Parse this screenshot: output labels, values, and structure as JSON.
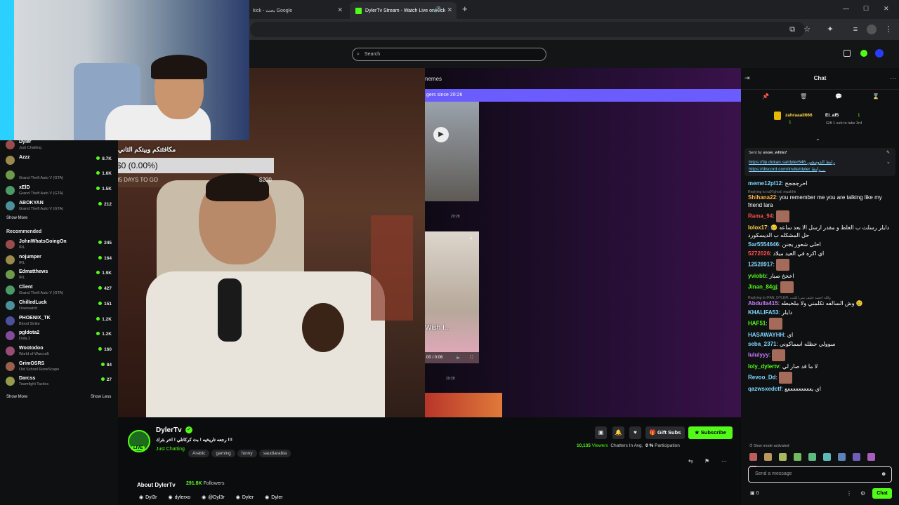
{
  "browser": {
    "tabs": [
      {
        "title": "kick - بحث Google",
        "active": false
      },
      {
        "title": "DylerTv Stream - Watch Live on Kick",
        "active": true
      }
    ],
    "new_tab": "+",
    "window_controls": {
      "minimize": "—",
      "maximize": "☐",
      "close": "✕"
    }
  },
  "kick": {
    "search_placeholder": "Search"
  },
  "sidebar": {
    "following": [
      {
        "name": "Dyler",
        "game": "Just Chatting",
        "viewers": ""
      },
      {
        "name": "Azzz",
        "game": "",
        "viewers": "8.7K"
      },
      {
        "name": "",
        "game": "Grand Theft Auto V (GTA)",
        "viewers": "1.6K"
      },
      {
        "name": "xElD",
        "game": "Grand Theft Auto V (GTA)",
        "viewers": "1.5K"
      },
      {
        "name": "ABOKYAN",
        "game": "Grand Theft Auto V (GTA)",
        "viewers": "212"
      }
    ],
    "show_more": "Show More",
    "recommended_label": "Recommended",
    "recommended": [
      {
        "name": "JohnWhatsGoingOn",
        "game": "IRL",
        "viewers": "245"
      },
      {
        "name": "nojumper",
        "game": "IRL",
        "viewers": "164"
      },
      {
        "name": "Edmatthews",
        "game": "IRL",
        "viewers": "1.9K"
      },
      {
        "name": "Client",
        "game": "Grand Theft Auto V (GTA)",
        "viewers": "427"
      },
      {
        "name": "ChilledLuck",
        "game": "Overwatch",
        "viewers": "151"
      },
      {
        "name": "PHOENIX_TK",
        "game": "Blood Strike",
        "viewers": "1.2K"
      },
      {
        "name": "pgldota2",
        "game": "Dota 2",
        "viewers": "1.2K"
      },
      {
        "name": "Wootodoo",
        "game": "World of Warcraft",
        "viewers": "160"
      },
      {
        "name": "GrimOSRS",
        "game": "Old School RuneScape",
        "viewers": "84"
      },
      {
        "name": "Darcss",
        "game": "Teamfight Tactics",
        "viewers": "27"
      }
    ],
    "show_more_2": "Show More",
    "show_less": "Show Less"
  },
  "overlay": {
    "goal_title": "مكافئتكم وبيتكم الثاني",
    "goal_amount": "$0 (0.00%)",
    "goal_progress": 0.0,
    "goal_left": "$0",
    "goal_days": "35 DAYS TO GO",
    "goal_target": "$200"
  },
  "video_side": {
    "header": "nemes",
    "subbar": "gers since 20:26",
    "time1": "20:28",
    "time2": "20:28",
    "wish_text": "Wish I...",
    "player_time": "00 / 0:06"
  },
  "stream": {
    "channel": "DylerTv",
    "live_badge": "LIVE",
    "title": "رجعه تاريخيه ! بث كركاتلي ! اخر بثرك !!!",
    "category": "Just Chatting",
    "tags": [
      "Arabic",
      "gaming",
      "funny",
      "saudiarabia"
    ],
    "viewers": "10,135",
    "viewers_label": "Viewers",
    "chatters_label": "Chatters In Avg.",
    "participation": "0 %",
    "participation_label": "Participation",
    "gift_subs": "Gift Subs",
    "subscribe": "Subscribe",
    "about_title": "About DylerTv",
    "followers": "291.8K",
    "followers_label": "Followers",
    "socials": [
      {
        "icon": "instagram-icon",
        "label": "Dyl3r"
      },
      {
        "icon": "x-icon",
        "label": "dylerxo"
      },
      {
        "icon": "youtube-icon",
        "label": "@Dyl3r"
      },
      {
        "icon": "discord-icon",
        "label": "Dyler"
      },
      {
        "icon": "tiktok-icon",
        "label": "Dyler"
      }
    ]
  },
  "chat": {
    "title": "Chat",
    "gifter": {
      "from": "zahraaali666",
      "to": "El_af5",
      "count": "1",
      "sub_count": "1",
      "note": "Gift 1 sub to take 3rd"
    },
    "pinned": {
      "sent_by_label": "Sent by",
      "sent_by": "snow_white7",
      "line1": "https://tip.dokan.sa/dyler646 رابط الدونيشن",
      "line2": "https://discord.com/invite/dyler رابط ..."
    },
    "messages": [
      {
        "user": "meme12pl12",
        "color": "#7fd6ff",
        "text": "احرجججج",
        "reply": ""
      },
      {
        "user": "Shihana22",
        "color": "#ffb347",
        "text": "you remember me you are talking like my friend lara",
        "reply": "Replying to ra97ghod: muahhh"
      },
      {
        "user": "Rama_94",
        "color": "#ff4d4d",
        "text": "",
        "reply": ""
      },
      {
        "user": "lolox17",
        "color": "#ffd24d",
        "text": "دايلر رسلت ب الغلط و مقدر ارسل الا بعد ساعه 😥 حل المشكله ب الديسكورد",
        "reply": ""
      },
      {
        "user": "Sar5554646",
        "color": "#7fd6ff",
        "text": "احلى شعور يجنن",
        "reply": ""
      },
      {
        "user": "5272026",
        "color": "#ff4d4d",
        "text": "اي اكره في العيد ميلاد",
        "reply": ""
      },
      {
        "user": "12528917",
        "color": "#7fd6ff",
        "text": "",
        "reply": ""
      },
      {
        "user": "yviobb",
        "color": "#53fc18",
        "text": "اخخخ صبار",
        "reply": ""
      },
      {
        "user": "Jinan_84gj",
        "color": "#53fc18",
        "text": "",
        "reply": ""
      },
      {
        "user": "Abdulla415",
        "color": "#c77dff",
        "text": "وش السالفه تكلمني ولا ملخبطه 😢",
        "reply": "Replying to IFAN_DYLER: والله احسد خليف بس الكثت"
      },
      {
        "user": "KHALIFA53",
        "color": "#7fd6ff",
        "text": "دايلر",
        "reply": ""
      },
      {
        "user": "HAF51",
        "color": "#53fc18",
        "text": "",
        "reply": ""
      },
      {
        "user": "HASAWAYHH",
        "color": "#7fd6ff",
        "text": "اي",
        "reply": ""
      },
      {
        "user": "seba_2371",
        "color": "#7fd6ff",
        "text": "سوولي حظله اسماكوني",
        "reply": ""
      },
      {
        "user": "lululyyy",
        "color": "#c77dff",
        "text": "",
        "reply": ""
      },
      {
        "user": "loly_dylertv",
        "color": "#53fc18",
        "text": "لا ما قد صار لي",
        "reply": ""
      },
      {
        "user": "Revoo_Dd",
        "color": "#7fd6ff",
        "text": "",
        "reply": ""
      },
      {
        "user": "qazwsxedctf",
        "color": "#7fd6ff",
        "text": "اي يعععععععععع",
        "reply": ""
      }
    ],
    "slow_mode": "Slow mode activated",
    "input_placeholder": "Send a message",
    "balance": "0",
    "send_label": "Chat"
  }
}
